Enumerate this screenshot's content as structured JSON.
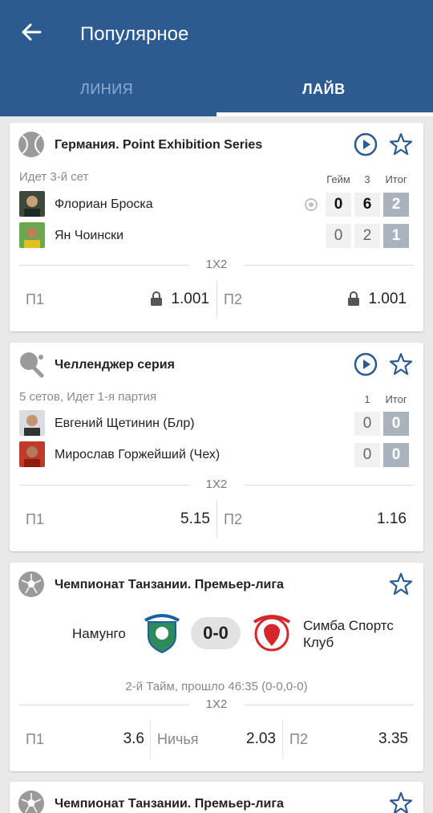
{
  "header": {
    "title": "Популярное",
    "tabs": [
      {
        "label": "ЛИНИЯ"
      },
      {
        "label": "ЛАЙВ"
      }
    ]
  },
  "colors": {
    "header": "#2b5b91",
    "accent": "#2b5b91",
    "score_total": "#a9b3be"
  },
  "events": [
    {
      "sport_icon": "tennis-ball-icon",
      "league": "Германия. Point Exhibition Series",
      "status": "Идет 3-й сет",
      "columns": [
        "Гейм",
        "3",
        "Итог"
      ],
      "players": [
        {
          "name": "Флориан Броска",
          "scores": [
            "0",
            "6",
            "2"
          ],
          "serving": true
        },
        {
          "name": "Ян Чоински",
          "scores": [
            "0",
            "2",
            "1"
          ],
          "serving": false
        }
      ],
      "market": "1X2",
      "odds": [
        {
          "label": "П1",
          "value": "1.001",
          "locked": true
        },
        {
          "label": "П2",
          "value": "1.001",
          "locked": true
        }
      ]
    },
    {
      "sport_icon": "table-tennis-icon",
      "league": "Челленджер серия",
      "status": "5 сетов, Идет 1-я партия",
      "columns": [
        "1",
        "Итог"
      ],
      "players": [
        {
          "name": "Евгений Щетинин (Блр)",
          "scores": [
            "0",
            "0"
          ]
        },
        {
          "name": "Мирослав Горжейший (Чех)",
          "scores": [
            "0",
            "0"
          ]
        }
      ],
      "market": "1X2",
      "odds": [
        {
          "label": "П1",
          "value": "5.15"
        },
        {
          "label": "П2",
          "value": "1.16"
        }
      ]
    },
    {
      "sport_icon": "soccer-ball-icon",
      "league": "Чемпионат Танзании. Премьер-лига",
      "home": "Намунго",
      "away": "Симба Спортс Клуб",
      "score": "0-0",
      "info": "2-й Тайм, прошло 46:35 (0-0,0-0)",
      "market": "1X2",
      "odds": [
        {
          "label": "П1",
          "value": "3.6"
        },
        {
          "label": "Ничья",
          "value": "2.03"
        },
        {
          "label": "П2",
          "value": "3.35"
        }
      ]
    },
    {
      "sport_icon": "soccer-ball-icon",
      "league": "Чемпионат Танзании. Премьер-лига"
    }
  ]
}
